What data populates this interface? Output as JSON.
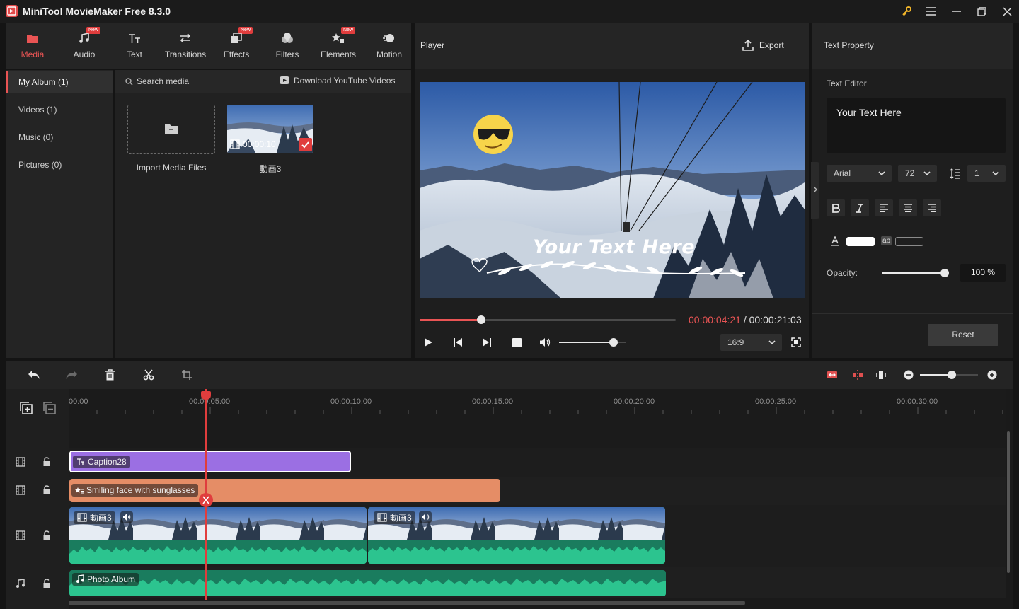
{
  "app": {
    "title": "MiniTool MovieMaker Free 8.3.0"
  },
  "toolbar": {
    "tabs": [
      {
        "label": "Media",
        "icon": "media-icon",
        "badge": ""
      },
      {
        "label": "Audio",
        "icon": "music-note-icon",
        "badge": "New"
      },
      {
        "label": "Text",
        "icon": "text-icon",
        "badge": ""
      },
      {
        "label": "Transitions",
        "icon": "transitions-icon",
        "badge": ""
      },
      {
        "label": "Effects",
        "icon": "effects-icon",
        "badge": "New"
      },
      {
        "label": "Filters",
        "icon": "filters-icon",
        "badge": ""
      },
      {
        "label": "Elements",
        "icon": "elements-icon",
        "badge": "New"
      },
      {
        "label": "Motion",
        "icon": "motion-icon",
        "badge": ""
      }
    ]
  },
  "sidebar": {
    "items": [
      {
        "label": "My Album (1)"
      },
      {
        "label": "Videos (1)"
      },
      {
        "label": "Music (0)"
      },
      {
        "label": "Pictures (0)"
      }
    ]
  },
  "media": {
    "search_placeholder": "Search media",
    "download_label": "Download YouTube Videos",
    "import_label": "Import Media Files",
    "items": [
      {
        "name": "動画3",
        "duration": "00:00:10"
      }
    ]
  },
  "player": {
    "title": "Player",
    "export_label": "Export",
    "overlay_text": "Your Text Here",
    "current_time": "00:00:04:21",
    "separator": " / ",
    "total_time": "00:00:21:03",
    "progress_fraction": 0.24,
    "volume_fraction": 0.82,
    "aspect_ratio": "16:9"
  },
  "text_property": {
    "title": "Text Property",
    "editor_label": "Text Editor",
    "editor_text": "Your Text Here",
    "font": "Arial",
    "size": "72",
    "line_spacing": "1",
    "opacity_label": "Opacity:",
    "opacity_value": "100 %",
    "opacity_fraction": 1.0,
    "reset_label": "Reset",
    "text_color": "#ffffff"
  },
  "timeline": {
    "zoom_fraction": 0.55,
    "playhead_time": "00:00:04:21",
    "ruler_labels": [
      "00:00",
      "00:00:05:00",
      "00:00:10:00",
      "00:00:15:00",
      "00:00:20:00",
      "00:00:25:00",
      "00:00:30:00"
    ],
    "clips": {
      "caption": "Caption28",
      "element": "Smiling face with sunglasses",
      "video": [
        "動画3",
        "動画3"
      ],
      "audio": "Photo Album"
    },
    "colors": {
      "caption": "#9b6fe3",
      "element": "#e58d66",
      "audio": "#27b98a",
      "playhead": "#e03d3d",
      "accent": "#e95454"
    }
  }
}
